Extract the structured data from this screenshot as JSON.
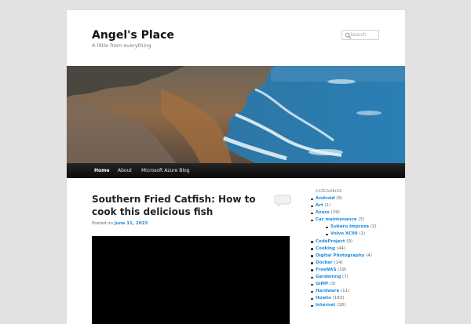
{
  "site": {
    "title": "Angel's Place",
    "tagline": "A little from everything"
  },
  "search": {
    "placeholder": "Search",
    "icon": "search-icon"
  },
  "header_image": {
    "description": "rocky coastline with ocean waves"
  },
  "nav": {
    "items": [
      {
        "label": "Home",
        "current": true
      },
      {
        "label": "About",
        "current": false
      },
      {
        "label": "Microsoft Azure Blog",
        "current": false
      }
    ]
  },
  "post": {
    "title": "Southern Fried Catfish: How to cook this delicious fish",
    "posted_on_label": "Posted on",
    "date": "June 11, 2023",
    "comment_icon": "comment-bubble-icon"
  },
  "sidebar": {
    "heading": "CATEGORIES",
    "categories": [
      {
        "name": "Android",
        "count": "(9)",
        "level": 0
      },
      {
        "name": "Art",
        "count": "(1)",
        "level": 0
      },
      {
        "name": "Azure",
        "count": "(39)",
        "level": 0
      },
      {
        "name": "Car maintenance",
        "count": "(3)",
        "level": 0
      },
      {
        "name": "Subaru Impreza",
        "count": "(2)",
        "level": 1
      },
      {
        "name": "Volvo XC90",
        "count": "(1)",
        "level": 1
      },
      {
        "name": "CodeProject",
        "count": "(9)",
        "level": 0
      },
      {
        "name": "Cooking",
        "count": "(44)",
        "level": 0
      },
      {
        "name": "Digital Photography",
        "count": "(4)",
        "level": 0
      },
      {
        "name": "Docker",
        "count": "(14)",
        "level": 0
      },
      {
        "name": "FreeNAS",
        "count": "(19)",
        "level": 0
      },
      {
        "name": "Gardening",
        "count": "(7)",
        "level": 0
      },
      {
        "name": "GIMP",
        "count": "(3)",
        "level": 0
      },
      {
        "name": "Hardware",
        "count": "(11)",
        "level": 0
      },
      {
        "name": "Howto",
        "count": "(183)",
        "level": 0
      },
      {
        "name": "Internet",
        "count": "(18)",
        "level": 0
      }
    ]
  },
  "colors": {
    "link": "#1b8be0",
    "nav_bg": "#111111",
    "page_bg": "#e2e2e2"
  }
}
